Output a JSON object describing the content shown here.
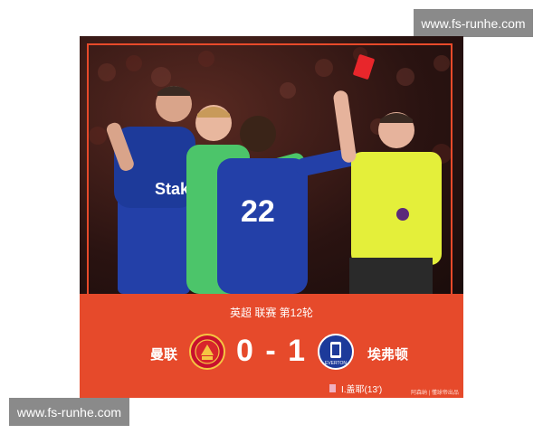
{
  "watermarks": {
    "top": "www.fs-runhe.com",
    "bottom": "www.fs-runhe.com"
  },
  "match": {
    "league": "英超  联赛  第12轮",
    "home_team": "曼联",
    "away_team": "埃弗顿",
    "score": "0 - 1",
    "event": "I.盖耶(13')",
    "event_icon": "red-card-icon",
    "credit": "阿森纳  |  懂球帝出品"
  },
  "photo": {
    "sponsor_text": "Stake",
    "shirt_number": "22",
    "league_badge": "premier-league-lion-icon"
  },
  "colors": {
    "banner": "#e64a2b",
    "frame": "#e84a2a",
    "everton_blue": "#1d3a9a",
    "referee_yellow": "#e4ef3a",
    "goalkeeper_green": "#4cc56a",
    "red_card": "#e8262b"
  }
}
